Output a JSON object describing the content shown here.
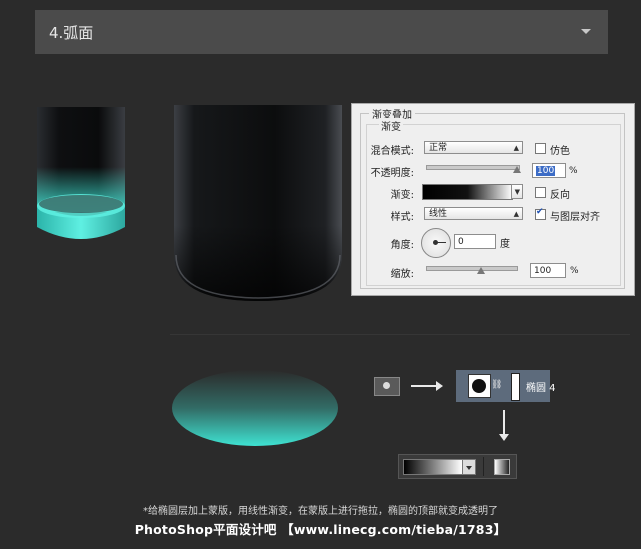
{
  "section": {
    "title": "4.弧面"
  },
  "style_panel": {
    "outer_title": "渐变叠加",
    "inner_title": "渐变",
    "blend_mode_label": "混合模式:",
    "blend_mode_value": "正常",
    "dither_label": "仿色",
    "opacity_label": "不透明度:",
    "opacity_value": "100",
    "opacity_unit": "%",
    "opacity_level": 1.0,
    "gradient_label": "渐变:",
    "reverse_label": "反向",
    "style_label": "样式:",
    "style_value": "线性",
    "align_label": "与图层对齐",
    "angle_label": "角度:",
    "angle_value": "0",
    "angle_unit": "度",
    "scale_label": "缩放:",
    "scale_value": "100",
    "scale_unit": "%",
    "scale_level": 0.5
  },
  "layer": {
    "name": "椭圆 4"
  },
  "caption": "*给椭圆层加上蒙版，用线性渐变，在蒙版上进行拖拉，椭圆的顶部就变成透明了",
  "footer": "PhotoShop平面设计吧 【www.linecg.com/tieba/1783】",
  "colors": {
    "background": "#2b2b2b",
    "header": "#4b4b4b",
    "cyan": "#3fe3d2",
    "layer_bg": "#5d6b7c"
  }
}
